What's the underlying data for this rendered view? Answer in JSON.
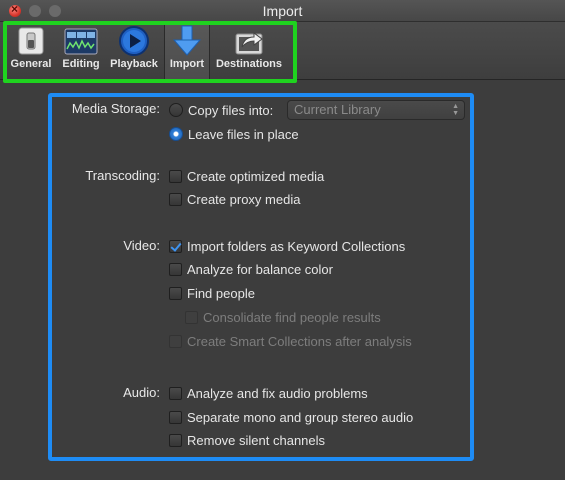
{
  "window": {
    "title": "Import"
  },
  "toolbar": {
    "items": [
      {
        "label": "General",
        "icon": "switch-icon"
      },
      {
        "label": "Editing",
        "icon": "timeline-icon"
      },
      {
        "label": "Playback",
        "icon": "play-icon"
      },
      {
        "label": "Import",
        "icon": "download-arrow-icon",
        "selected": true
      },
      {
        "label": "Destinations",
        "icon": "share-icon"
      }
    ]
  },
  "media_storage": {
    "label": "Media Storage:",
    "copy_option": "Copy files into:",
    "copy_selected": false,
    "library_popup": "Current Library",
    "leave_option": "Leave files in place",
    "leave_selected": true
  },
  "transcoding": {
    "label": "Transcoding:",
    "options": [
      {
        "text": "Create optimized media",
        "checked": false
      },
      {
        "text": "Create proxy media",
        "checked": false
      }
    ]
  },
  "video": {
    "label": "Video:",
    "options": [
      {
        "text": "Import folders as Keyword Collections",
        "checked": true
      },
      {
        "text": "Analyze for balance color",
        "checked": false
      },
      {
        "text": "Find people",
        "checked": false
      },
      {
        "text": "Consolidate find people results",
        "checked": false,
        "disabled": true
      },
      {
        "text": "Create Smart Collections after analysis",
        "checked": false,
        "disabled": true
      }
    ]
  },
  "audio": {
    "label": "Audio:",
    "options": [
      {
        "text": "Analyze and fix audio problems",
        "checked": false
      },
      {
        "text": "Separate mono and group stereo audio",
        "checked": false
      },
      {
        "text": "Remove silent channels",
        "checked": false
      }
    ]
  },
  "highlight_colors": {
    "toolbar": "#1fd31f",
    "settings": "#1e8cf5"
  }
}
